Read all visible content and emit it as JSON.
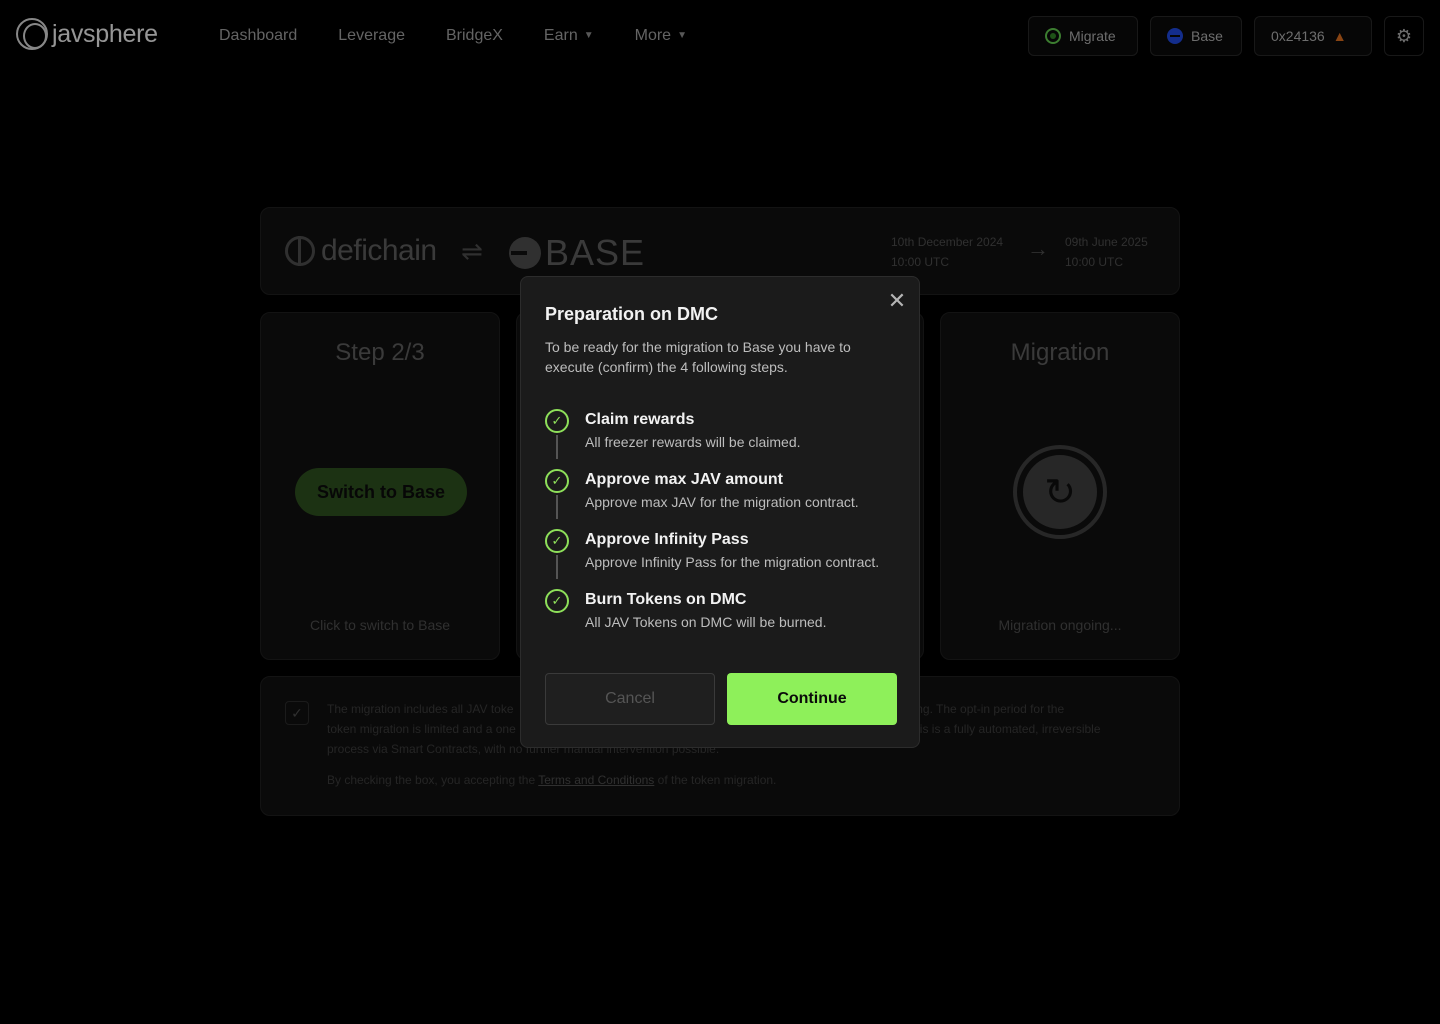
{
  "header": {
    "logo_text": "javsphere",
    "nav": [
      {
        "label": "Dashboard",
        "has_dropdown": false
      },
      {
        "label": "Leverage",
        "has_dropdown": false
      },
      {
        "label": "BridgeX",
        "has_dropdown": false
      },
      {
        "label": "Earn",
        "has_dropdown": true
      },
      {
        "label": "More",
        "has_dropdown": true
      }
    ],
    "migrate_label": "Migrate",
    "network_label": "Base",
    "wallet_label": "0x24136",
    "icons": [
      "migrate-icon",
      "base-network-icon",
      "metamask-fox-icon",
      "gear-icon"
    ]
  },
  "banner": {
    "from_chain": "defichain",
    "to_chain": "BASE",
    "start_date": "10th December 2024",
    "start_time": "10:00 UTC",
    "end_date": "09th June 2025",
    "end_time": "10:00 UTC"
  },
  "step_card": {
    "title": "Step 2/3",
    "button_label": "Switch to Base",
    "footer": "Click to switch to Base"
  },
  "migration_card": {
    "title": "Migration",
    "footer": "Migration ongoing..."
  },
  "terms": {
    "text_visible_left": "The migration includes all JAV toke",
    "text_visible_right": "nd Vesting. The opt-in period for the",
    "line2_left": "token migration is limited and a one",
    "line2_right": "This is a fully automated, irreversible",
    "line3": "process via Smart Contracts, with no further manual intervention possible.",
    "accept_prefix": "By checking the box, you accepting the ",
    "accept_link": "Terms and Conditions",
    "accept_suffix": " of the token migration."
  },
  "modal": {
    "title": "Preparation on DMC",
    "description": "To be ready for the migration to Base you have to execute (confirm) the 4 following steps.",
    "steps": [
      {
        "title": "Claim rewards",
        "desc": "All freezer rewards will be claimed.",
        "done": true
      },
      {
        "title": "Approve max JAV amount",
        "desc": "Approve max JAV for the migration contract.",
        "done": true
      },
      {
        "title": "Approve Infinity Pass",
        "desc": "Approve Infinity Pass for the migration contract.",
        "done": true
      },
      {
        "title": "Burn Tokens on DMC",
        "desc": "All JAV Tokens on DMC will be burned.",
        "done": true
      }
    ],
    "cancel_label": "Cancel",
    "continue_label": "Continue"
  },
  "colors": {
    "accent": "#8ef05a",
    "background": "#000000",
    "modal_bg": "#1b1b1b"
  }
}
